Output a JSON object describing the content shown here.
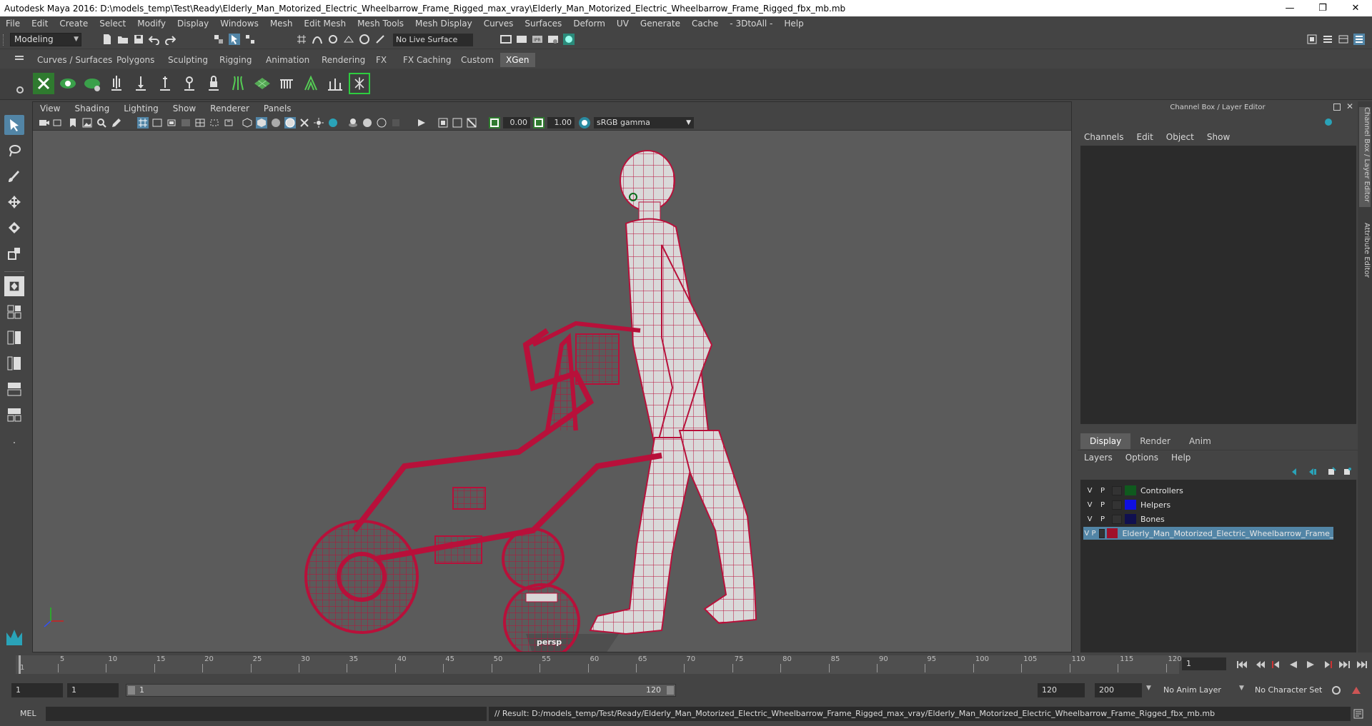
{
  "window": {
    "title": "Autodesk Maya 2016: D:\\models_temp\\Test\\Ready\\Elderly_Man_Motorized_Electric_Wheelbarrow_Frame_Rigged_max_vray\\Elderly_Man_Motorized_Electric_Wheelbarrow_Frame_Rigged_fbx_mb.mb",
    "controls": [
      "minimize-icon",
      "restore-icon",
      "close-icon"
    ]
  },
  "menubar": [
    "File",
    "Edit",
    "Create",
    "Select",
    "Modify",
    "Display",
    "Windows",
    "Mesh",
    "Edit Mesh",
    "Mesh Tools",
    "Mesh Display",
    "Curves",
    "Surfaces",
    "Deform",
    "UV",
    "Generate",
    "Cache",
    "- 3DtoAll -",
    "Help"
  ],
  "statusline": {
    "mode": "Modeling",
    "live_surface": "No Live Surface"
  },
  "shelf": {
    "tabs": [
      "Curves / Surfaces",
      "Polygons",
      "Sculpting",
      "Rigging",
      "Animation",
      "Rendering",
      "FX",
      "FX Caching",
      "Custom",
      "XGen"
    ],
    "active_tab": "XGen"
  },
  "viewport": {
    "menu": [
      "View",
      "Shading",
      "Lighting",
      "Show",
      "Renderer",
      "Panels"
    ],
    "exposure": "0.00",
    "gamma_value": "1.00",
    "color_space": "sRGB gamma",
    "camera_label": "persp"
  },
  "channel_box": {
    "header": "Channel Box / Layer Editor",
    "menu": [
      "Channels",
      "Edit",
      "Object",
      "Show"
    ]
  },
  "layer_editor": {
    "tabs": [
      "Display",
      "Render",
      "Anim"
    ],
    "active_tab": "Display",
    "menu": [
      "Layers",
      "Options",
      "Help"
    ],
    "layers": [
      {
        "v": "V",
        "p": "P",
        "name": "Controllers",
        "color": "#0f5a1e"
      },
      {
        "v": "V",
        "p": "P",
        "name": "Helpers",
        "color": "#1010e0"
      },
      {
        "v": "V",
        "p": "P",
        "name": "Bones",
        "color": "#101050"
      },
      {
        "v": "V",
        "p": "P",
        "name": "Elderly_Man_Motorized_Electric_Wheelbarrow_Frame_Ri",
        "color": "#a0102a",
        "selected": true
      }
    ]
  },
  "side_tabs": [
    "Channel Box / Layer Editor",
    "Attribute Editor"
  ],
  "timeline": {
    "ticks": [
      "5",
      "10",
      "15",
      "20",
      "25",
      "30",
      "35",
      "40",
      "45",
      "50",
      "55",
      "60",
      "65",
      "70",
      "75",
      "80",
      "85",
      "90",
      "95",
      "100",
      "105",
      "110",
      "115",
      "120"
    ],
    "start_label": "1",
    "current_frame": "1"
  },
  "range": {
    "start": "1",
    "playback_start": "1",
    "slider_start": "1",
    "slider_end": "120",
    "playback_end": "120",
    "end": "200",
    "anim_layer": "No Anim Layer",
    "character_set": "No Character Set"
  },
  "cmdline": {
    "label": "MEL",
    "result": "// Result: D:/models_temp/Test/Ready/Elderly_Man_Motorized_Electric_Wheelbarrow_Frame_Rigged_max_vray/Elderly_Man_Motorized_Electric_Wheelbarrow_Frame_Rigged_fbx_mb.mb"
  },
  "colors": {
    "accent": "#5285a6",
    "wireframe": "#b8103a",
    "viewport_bg": "#5b5b5b"
  }
}
